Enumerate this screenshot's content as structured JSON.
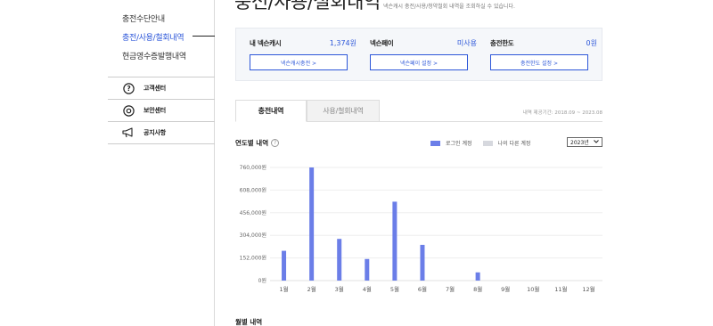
{
  "sidebar": {
    "items": [
      {
        "label": "충전수단안내"
      },
      {
        "label": "충전/사용/철회내역"
      },
      {
        "label": "현금영수증발행내역"
      }
    ],
    "help": [
      {
        "label": "고객센터",
        "icon": "question-circle-icon"
      },
      {
        "label": "보안센터",
        "icon": "lock-circle-icon"
      },
      {
        "label": "공지사항",
        "icon": "megaphone-icon"
      }
    ]
  },
  "header": {
    "title": "충전/사용/철회내역",
    "description": "넥슨캐시 충전/사용/청약철회 내역을 조회하실 수 있습니다."
  },
  "summary": {
    "cash": {
      "label": "내 넥슨캐시",
      "value": "1,374원",
      "button": "넥슨캐시충전 >"
    },
    "pay": {
      "label": "넥슨페이",
      "value": "미사용",
      "button": "넥슨페이 설정 >"
    },
    "limit": {
      "label": "충전한도",
      "value": "0원",
      "button": "충전한도 설정 >"
    }
  },
  "tabs": [
    {
      "label": "충전내역",
      "active": true
    },
    {
      "label": "사용/철회내역",
      "active": false
    }
  ],
  "period": "내역 제공기간: 2018.09 ~ 2023.08",
  "yearly": {
    "title": "연도별 내역",
    "legend": [
      {
        "label": "로그인 계정",
        "color": "#6b7ee8"
      },
      {
        "label": "나의 다른 계정",
        "color": "#d6d8de"
      }
    ],
    "year_select": "2023년"
  },
  "chart_data": {
    "type": "bar",
    "categories": [
      "1월",
      "2월",
      "3월",
      "4월",
      "5월",
      "6월",
      "7월",
      "8월",
      "9월",
      "10월",
      "11월",
      "12월"
    ],
    "series": [
      {
        "name": "로그인 계정",
        "values": [
          200000,
          760000,
          280000,
          145000,
          530000,
          240000,
          0,
          55000,
          0,
          0,
          0,
          0
        ]
      }
    ],
    "yticks": [
      "0원",
      "152,000원",
      "304,000원",
      "456,000원",
      "608,000원",
      "760,000원"
    ],
    "ylim": [
      0,
      760000
    ],
    "bar_color": "#6b7ee8"
  },
  "monthly": {
    "title": "월별 내역"
  }
}
